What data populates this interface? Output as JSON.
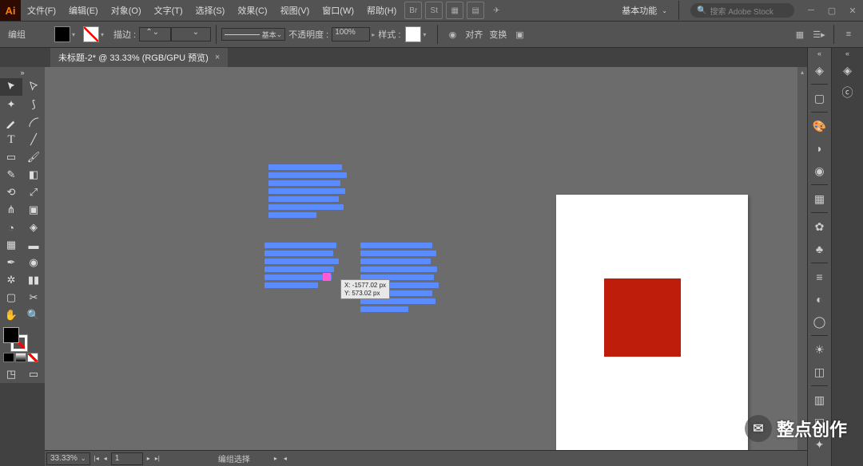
{
  "app": {
    "logo": "Ai"
  },
  "menu": [
    "文件(F)",
    "编辑(E)",
    "对象(O)",
    "文字(T)",
    "选择(S)",
    "效果(C)",
    "视图(V)",
    "窗口(W)",
    "帮助(H)"
  ],
  "menuIcons": [
    "Br",
    "St",
    "▦",
    "▤",
    "✈"
  ],
  "workspace": "基本功能",
  "search_placeholder": "搜索 Adobe Stock",
  "ctrl": {
    "mode": "编组",
    "stroke_label": "描边 :",
    "stroke_style": "基本",
    "opacity_label": "不透明度 :",
    "opacity_value": "100%",
    "style_label": "样式 :",
    "align": "对齐",
    "transform": "变换"
  },
  "doc": {
    "tab": "未标题-2* @ 33.33% (RGB/GPU 预览)"
  },
  "coord": {
    "x": "X: -1577.02 px",
    "y": "Y: 573.02 px"
  },
  "status": {
    "zoom": "33.33%",
    "page": "1",
    "label": "编组选择"
  },
  "watermark": "整点创作"
}
